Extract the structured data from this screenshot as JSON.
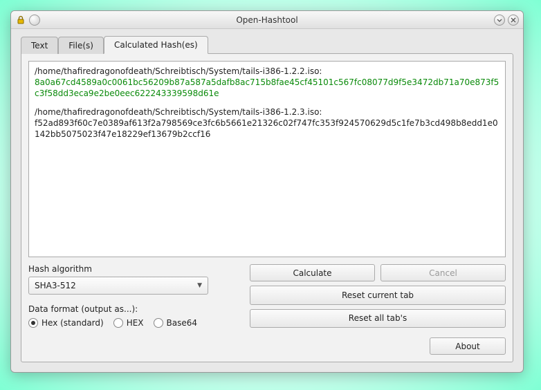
{
  "window": {
    "title": "Open-Hashtool"
  },
  "tabs": {
    "text": "Text",
    "files": "File(s)",
    "calculated": "Calculated Hash(es)"
  },
  "results": [
    {
      "path": "/home/thafiredragonofdeath/Schreibtisch/System/tails-i386-1.2.2.iso:",
      "hash": "8a0a67cd4589a0c0061bc56209b87a587a5dafb8ac715b8fae45cf45101c567fc08077d9f5e3472db71a70e873f5c3f58dd3eca9e2be0eec622243339598d61e",
      "verified": true
    },
    {
      "path": "/home/thafiredragonofdeath/Schreibtisch/System/tails-i386-1.2.3.iso:",
      "hash": "f52ad893f60c7e0389af613f2a798569ce3fc6b5661e21326c02f747fc353f924570629d5c1fe7b3cd498b8edd1e0142bb5075023f47e18229ef13679b2ccf16",
      "verified": false
    }
  ],
  "algorithm": {
    "label": "Hash algorithm",
    "value": "SHA3-512"
  },
  "format": {
    "label": "Data format (output as...):",
    "options": {
      "hex_std": "Hex (standard)",
      "hex_upper": "HEX",
      "base64": "Base64"
    },
    "selected": "hex_std"
  },
  "buttons": {
    "calculate": "Calculate",
    "cancel": "Cancel",
    "reset_current": "Reset current tab",
    "reset_all": "Reset all tab's",
    "about": "About"
  }
}
